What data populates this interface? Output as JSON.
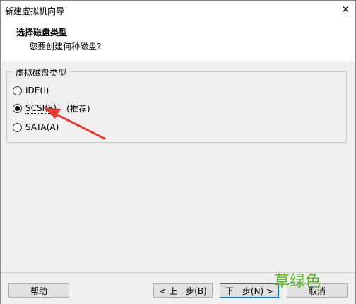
{
  "window": {
    "title": "新建虚拟机向导",
    "close_glyph": "✕"
  },
  "header": {
    "title": "选择磁盘类型",
    "subtitle": "您要创建何种磁盘?"
  },
  "disk_type_group": {
    "legend": "虚拟磁盘类型",
    "options": [
      {
        "label": "IDE(I)",
        "selected": false
      },
      {
        "label": "SCSI(S)",
        "selected": true,
        "note": "(推荐)"
      },
      {
        "label": "SATA(A)",
        "selected": false
      }
    ]
  },
  "buttons": {
    "help": "帮助",
    "back": "< 上一步(B)",
    "next": "下一步(N) >",
    "cancel": "取消"
  },
  "overlay": {
    "watermark": "草绿色",
    "arrow_color": "#e53b32"
  }
}
